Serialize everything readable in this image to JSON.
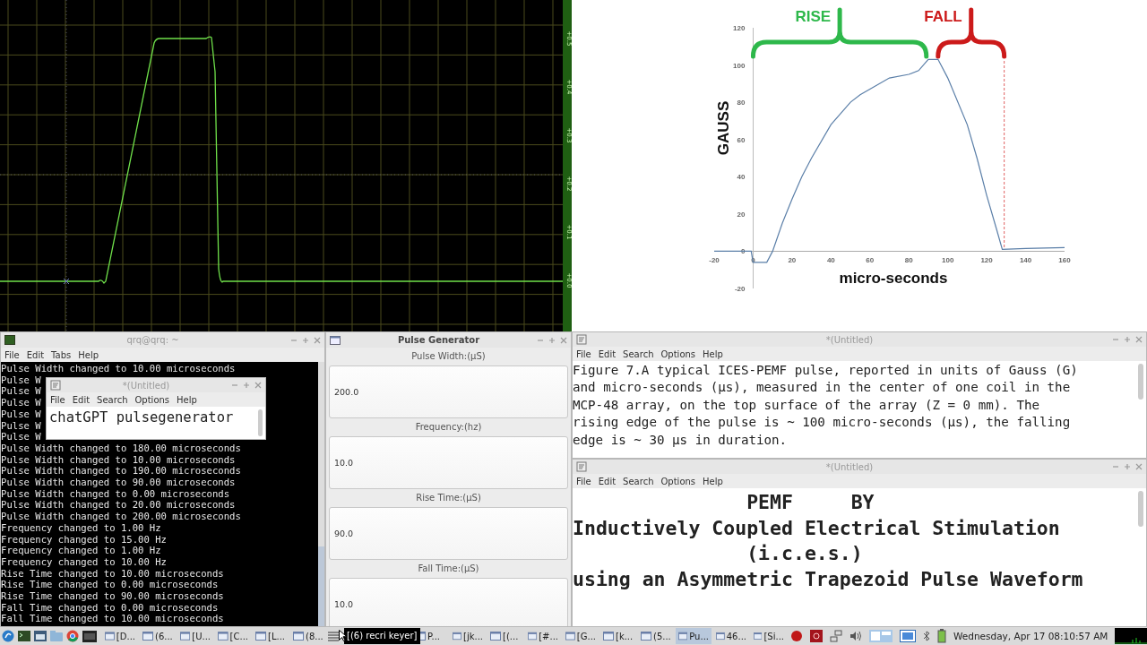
{
  "scope": {
    "scale_labels": [
      "+0.5",
      "+0.4",
      "+0.3",
      "+0.2",
      "+0.1",
      "+0.0"
    ]
  },
  "chart": {
    "chart_data": {
      "type": "line",
      "xlabel": "micro-seconds",
      "ylabel": "GAUSS",
      "x": [
        -20,
        -10,
        -3,
        -1,
        0,
        7,
        10,
        15,
        20,
        25,
        30,
        40,
        50,
        55,
        60,
        70,
        80,
        85,
        90,
        95,
        100,
        110,
        115,
        120,
        125,
        128,
        140,
        160
      ],
      "series": [
        {
          "color": "#5b7fa8",
          "values": [
            0,
            0,
            0,
            0,
            -6,
            -6,
            0,
            15,
            28,
            40,
            50,
            68,
            80,
            84,
            87,
            93,
            95,
            97,
            103,
            103,
            93,
            68,
            50,
            30,
            12,
            1,
            1.5,
            2
          ]
        }
      ],
      "xlim": [
        -20,
        160
      ],
      "ylim": [
        -20,
        120
      ],
      "xticks": [
        -20,
        0,
        20,
        40,
        60,
        80,
        100,
        120,
        140,
        160
      ],
      "yticks": [
        -20,
        0,
        20,
        40,
        60,
        80,
        100,
        120
      ],
      "annotations": [
        {
          "text": "RISE"
        },
        {
          "text": "FALL"
        }
      ],
      "ref_lines": [
        {
          "axis": "x",
          "value": 129,
          "color": "#e06060"
        }
      ]
    }
  },
  "terminal": {
    "title": "qrq@qrq: ~",
    "menu": [
      "File",
      "Edit",
      "Tabs",
      "Help"
    ],
    "lines": [
      "Pulse Width changed to 10.00 microseconds",
      "Pulse W",
      "Pulse W",
      "Pulse W",
      "Pulse W",
      "Pulse W",
      "Pulse W",
      "Pulse Width changed to 180.00 microseconds",
      "Pulse Width changed to 10.00 microseconds",
      "Pulse Width changed to 190.00 microseconds",
      "Pulse Width changed to 90.00 microseconds",
      "Pulse Width changed to 0.00 microseconds",
      "Pulse Width changed to 20.00 microseconds",
      "Pulse Width changed to 200.00 microseconds",
      "Frequency changed to 1.00 Hz",
      "Frequency changed to 15.00 Hz",
      "Frequency changed to 1.00 Hz",
      "Frequency changed to 10.00 Hz",
      "Rise Time changed to 10.00 microseconds",
      "Rise Time changed to 0.00 microseconds",
      "Rise Time changed to 90.00 microseconds",
      "Fall Time changed to 0.00 microseconds",
      "Fall Time changed to 10.00 microseconds"
    ]
  },
  "editor_popup": {
    "title": "*(Untitled)",
    "menu": [
      "File",
      "Edit",
      "Search",
      "Options",
      "Help"
    ],
    "text": "chatGPT pulsegenerator"
  },
  "pulse_generator": {
    "title": "Pulse Generator",
    "fields": [
      {
        "label": "Pulse Width:(µS)",
        "value": "200.0"
      },
      {
        "label": "Frequency:(hz)",
        "value": "10.0"
      },
      {
        "label": "Rise Time:(µS)",
        "value": "90.0"
      },
      {
        "label": "Fall Time:(µS)",
        "value": "10.0"
      }
    ]
  },
  "editors": [
    {
      "title": "*(Untitled)",
      "menu": [
        "File",
        "Edit",
        "Search",
        "Options",
        "Help"
      ],
      "kind": "paragraph",
      "text": "Figure 7.A typical ICES-PEMF pulse, reported in units of Gauss (G) and micro-seconds (µs), measured in the center of one coil in the MCP-48 array, on the top surface of the array (Z = 0 mm). The rising edge of the pulse is ~ 100 micro-seconds (µs), the falling edge is ~ 30 µs in duration."
    },
    {
      "title": "*(Untitled)",
      "menu": [
        "File",
        "Edit",
        "Search",
        "Options",
        "Help"
      ],
      "kind": "lines",
      "lines": [
        "               PEMF     BY",
        "Inductively Coupled Electrical Stimulation",
        "               (i.c.e.s.)",
        "using an Asymmetric Trapezoid Pulse Waveform"
      ]
    }
  ],
  "taskbar": {
    "tasks": [
      {
        "label": "[D...",
        "selected": false
      },
      {
        "label": "(6...",
        "selected": false
      },
      {
        "label": "[U...",
        "selected": false
      },
      {
        "label": "[C...",
        "selected": false
      },
      {
        "label": "[L...",
        "selected": false
      },
      {
        "label": "(8...",
        "selected": false
      },
      {
        "label": "P...",
        "selected": false
      },
      {
        "label": "[jk...",
        "selected": false
      },
      {
        "label": "[(...",
        "selected": false
      },
      {
        "label": "[#...",
        "selected": false
      },
      {
        "label": "[G...",
        "selected": false
      },
      {
        "label": "[k...",
        "selected": false
      },
      {
        "label": "(5...",
        "selected": false
      },
      {
        "label": "Pu...",
        "selected": true
      },
      {
        "label": "46...",
        "selected": false
      },
      {
        "label": "[Si...",
        "selected": false
      }
    ],
    "tooltip": "[(6) recri keyer]",
    "clock": "Wednesday, Apr 17 08:10:57 AM"
  }
}
